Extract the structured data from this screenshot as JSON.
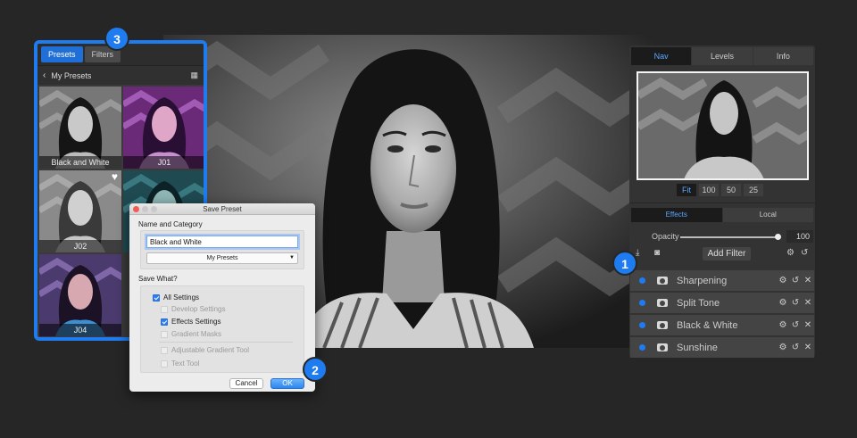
{
  "badges": {
    "one": "1",
    "two": "2",
    "three": "3"
  },
  "presets": {
    "tabs": [
      {
        "label": "Presets"
      },
      {
        "label": "Filters"
      }
    ],
    "header": {
      "back": "‹",
      "title": "My Presets",
      "grid": "▦"
    },
    "items": [
      {
        "label": "Black and White"
      },
      {
        "label": "J01"
      },
      {
        "label": "J02",
        "favorite": "♥"
      },
      {
        "label": ""
      },
      {
        "label": "J04"
      }
    ]
  },
  "dialog": {
    "title": "Save Preset",
    "name_category_label": "Name and Category",
    "name_value": "Black and White",
    "category_value": "My Presets",
    "save_what_label": "Save What?",
    "options": {
      "all_settings": "All Settings",
      "develop_settings": "Develop Settings",
      "effects_settings": "Effects Settings",
      "gradient_masks": "Gradient Masks",
      "adjustable_gradient": "Adjustable Gradient Tool",
      "text_tool": "Text Tool"
    },
    "cancel_label": "Cancel",
    "ok_label": "OK"
  },
  "right_panel": {
    "tabs": [
      {
        "label": "Nav"
      },
      {
        "label": "Levels"
      },
      {
        "label": "Info"
      }
    ],
    "zoom": [
      {
        "label": "Fit"
      },
      {
        "label": "100"
      },
      {
        "label": "50"
      },
      {
        "label": "25"
      }
    ],
    "effects_tabs": [
      {
        "label": "Effects"
      },
      {
        "label": "Local"
      }
    ],
    "opacity_label": "Opacity",
    "opacity_value": "100",
    "add_filter_label": "Add Filter",
    "filters": [
      {
        "name": "Sharpening"
      },
      {
        "name": "Split Tone"
      },
      {
        "name": "Black & White"
      },
      {
        "name": "Sunshine"
      }
    ]
  },
  "colors": {
    "accent": "#1e7bf0",
    "panel": "#333333",
    "background": "#262626"
  }
}
